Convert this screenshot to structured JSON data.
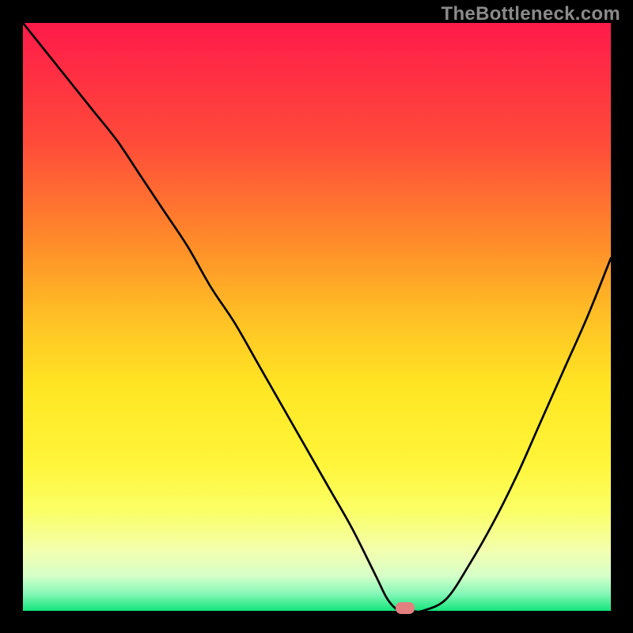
{
  "watermark": "TheBottleneck.com",
  "colors": {
    "background": "#000000",
    "curve": "#000000",
    "marker": "#e37f7f",
    "gradient_stops": [
      "#ff1a4a",
      "#ff4a3a",
      "#ff8a2a",
      "#ffc025",
      "#ffe624",
      "#fff53a",
      "#fbff66",
      "#f2ffb0",
      "#d6ffc8",
      "#88f8b8",
      "#13e57c"
    ]
  },
  "chart_data": {
    "type": "line",
    "title": "",
    "xlabel": "",
    "ylabel": "",
    "xlim": [
      0,
      100
    ],
    "ylim": [
      0,
      100
    ],
    "x": [
      0,
      4,
      8,
      12,
      16,
      20,
      24,
      28,
      32,
      36,
      40,
      44,
      48,
      52,
      56,
      60,
      62,
      64,
      66,
      68,
      72,
      76,
      80,
      84,
      88,
      92,
      96,
      100
    ],
    "values": [
      100,
      95,
      90,
      85,
      80,
      74,
      68,
      62,
      55,
      49,
      42,
      35,
      28,
      21,
      14,
      6,
      2,
      0,
      0,
      0,
      2,
      8,
      15,
      23,
      32,
      41,
      50,
      60
    ],
    "flat_region_x": [
      60,
      68
    ],
    "marker": {
      "x": 65,
      "y": 0
    }
  }
}
